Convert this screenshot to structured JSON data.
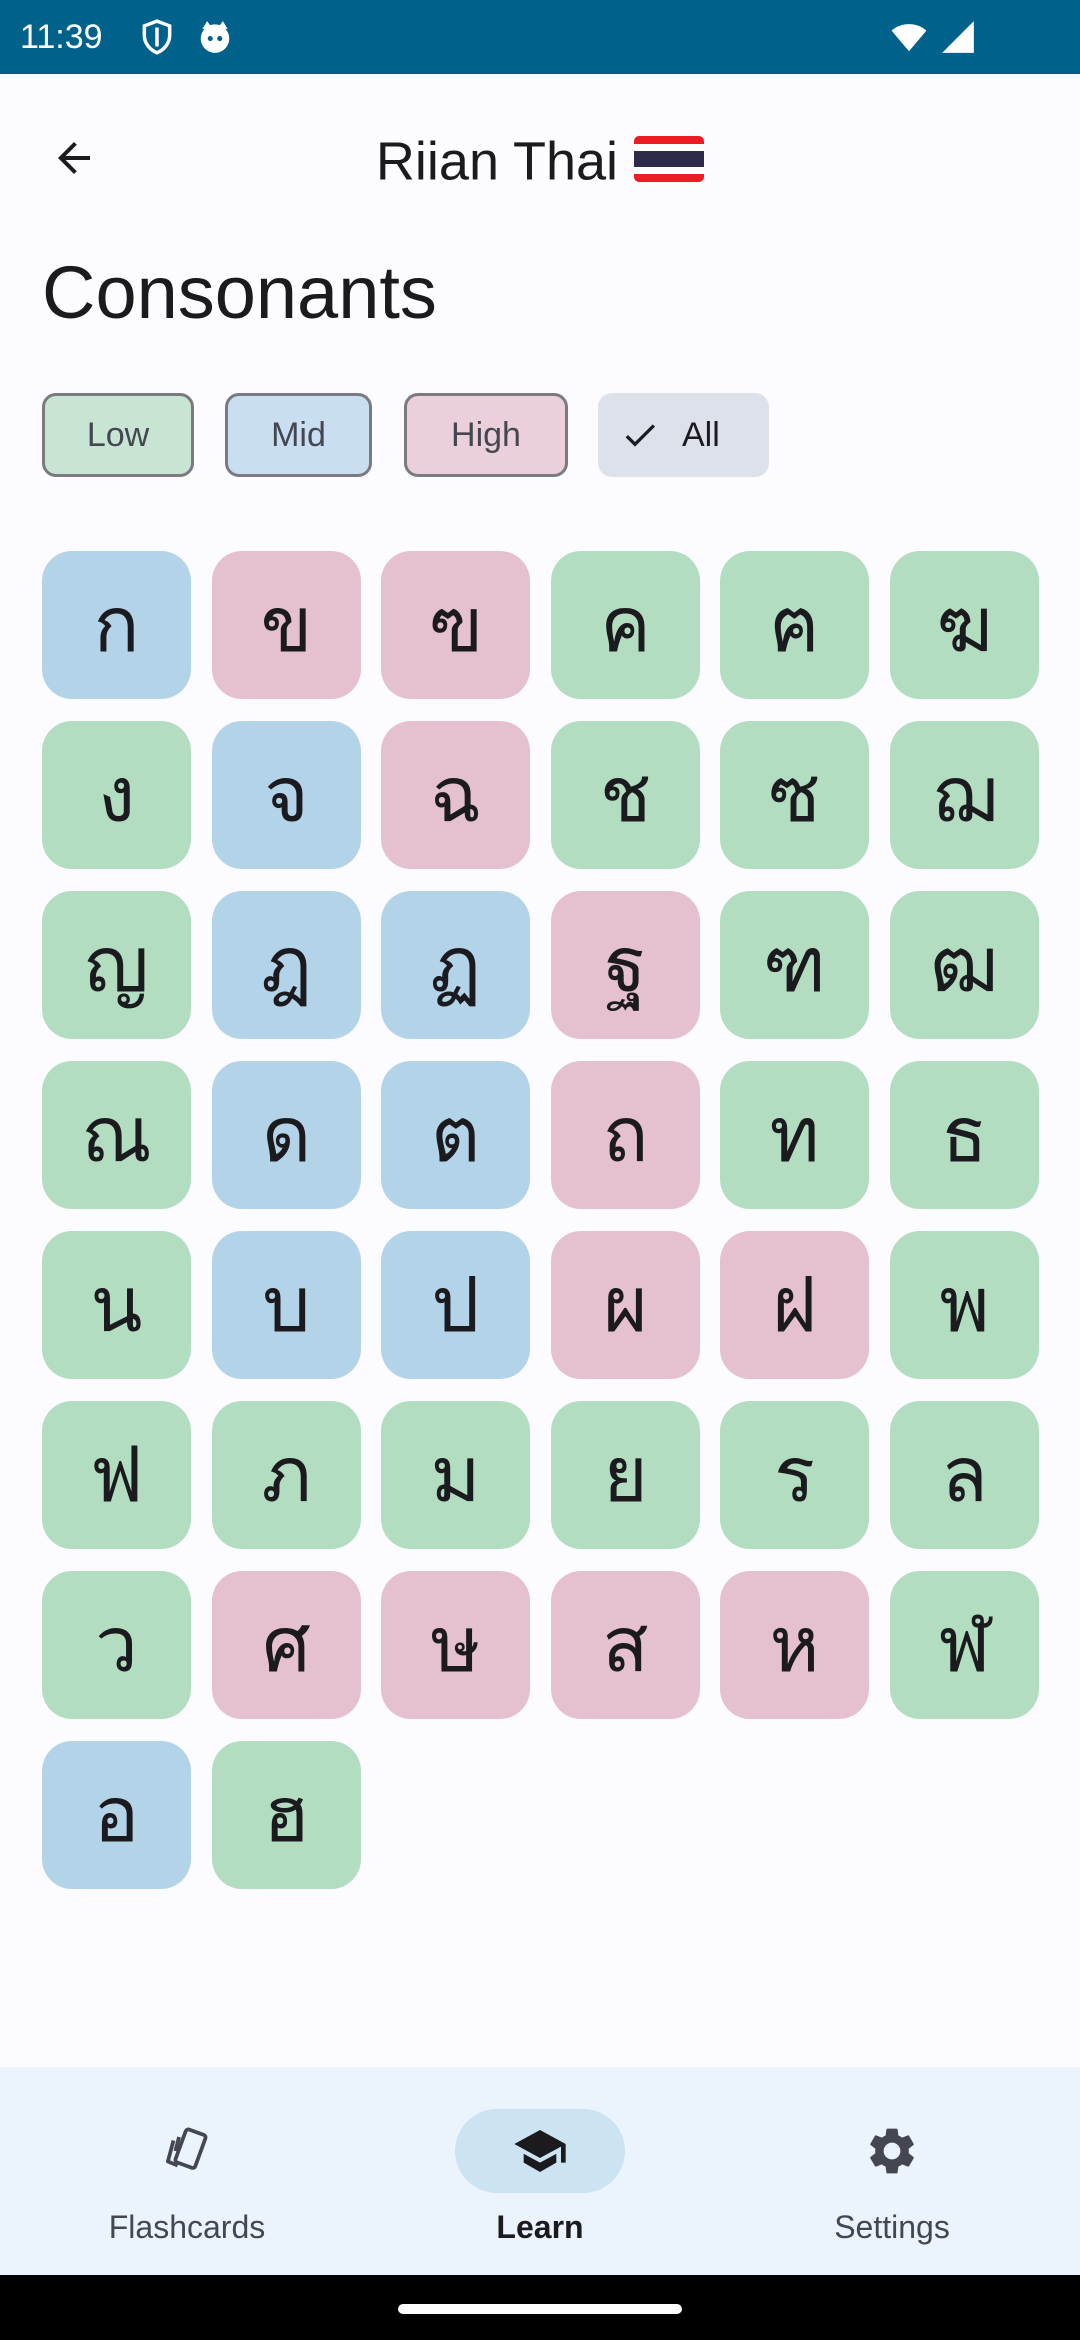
{
  "status_bar": {
    "time": "11:39",
    "icons": [
      "shield-icon",
      "cat-icon",
      "wifi-icon",
      "signal-icon"
    ]
  },
  "app_bar": {
    "title": "Riian Thai",
    "flag": "thailand-flag-icon",
    "back_icon": "arrow-back-icon"
  },
  "heading": "Consonants",
  "filters": {
    "low": "Low",
    "mid": "Mid",
    "high": "High",
    "all": "All",
    "selected": "All"
  },
  "colors": {
    "low": "#B3DDC0",
    "mid": "#B3D3E9",
    "high": "#E5C0CF",
    "status_bar": "#00628B"
  },
  "consonants": [
    {
      "char": "ก",
      "class": "mid"
    },
    {
      "char": "ข",
      "class": "high"
    },
    {
      "char": "ฃ",
      "class": "high"
    },
    {
      "char": "ค",
      "class": "low"
    },
    {
      "char": "ฅ",
      "class": "low"
    },
    {
      "char": "ฆ",
      "class": "low"
    },
    {
      "char": "ง",
      "class": "low"
    },
    {
      "char": "จ",
      "class": "mid"
    },
    {
      "char": "ฉ",
      "class": "high"
    },
    {
      "char": "ช",
      "class": "low"
    },
    {
      "char": "ซ",
      "class": "low"
    },
    {
      "char": "ฌ",
      "class": "low"
    },
    {
      "char": "ญ",
      "class": "low"
    },
    {
      "char": "ฎ",
      "class": "mid"
    },
    {
      "char": "ฏ",
      "class": "mid"
    },
    {
      "char": "ฐ",
      "class": "high"
    },
    {
      "char": "ฑ",
      "class": "low"
    },
    {
      "char": "ฒ",
      "class": "low"
    },
    {
      "char": "ณ",
      "class": "low"
    },
    {
      "char": "ด",
      "class": "mid"
    },
    {
      "char": "ต",
      "class": "mid"
    },
    {
      "char": "ถ",
      "class": "high"
    },
    {
      "char": "ท",
      "class": "low"
    },
    {
      "char": "ธ",
      "class": "low"
    },
    {
      "char": "น",
      "class": "low"
    },
    {
      "char": "บ",
      "class": "mid"
    },
    {
      "char": "ป",
      "class": "mid"
    },
    {
      "char": "ผ",
      "class": "high"
    },
    {
      "char": "ฝ",
      "class": "high"
    },
    {
      "char": "พ",
      "class": "low"
    },
    {
      "char": "ฟ",
      "class": "low"
    },
    {
      "char": "ภ",
      "class": "low"
    },
    {
      "char": "ม",
      "class": "low"
    },
    {
      "char": "ย",
      "class": "low"
    },
    {
      "char": "ร",
      "class": "low"
    },
    {
      "char": "ล",
      "class": "low"
    },
    {
      "char": "ว",
      "class": "low"
    },
    {
      "char": "ศ",
      "class": "high"
    },
    {
      "char": "ษ",
      "class": "high"
    },
    {
      "char": "ส",
      "class": "high"
    },
    {
      "char": "ห",
      "class": "high"
    },
    {
      "char": "ฬ",
      "class": "low"
    },
    {
      "char": "อ",
      "class": "mid"
    },
    {
      "char": "ฮ",
      "class": "low"
    }
  ],
  "bottom_nav": [
    {
      "label": "Flashcards",
      "icon": "flashcards-icon",
      "selected": false
    },
    {
      "label": "Learn",
      "icon": "graduation-cap-icon",
      "selected": true
    },
    {
      "label": "Settings",
      "icon": "gear-icon",
      "selected": false
    }
  ]
}
